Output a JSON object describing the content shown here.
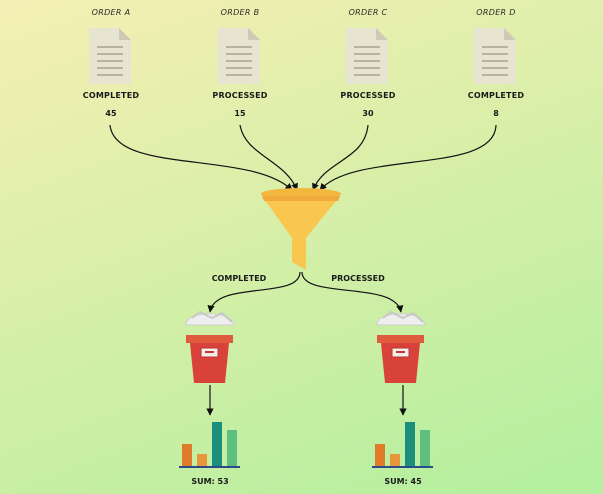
{
  "orders": [
    {
      "title": "ORDER A",
      "status": "COMPLETED",
      "count": "45"
    },
    {
      "title": "ORDER B",
      "status": "PROCESSED",
      "count": "15"
    },
    {
      "title": "ORDER C",
      "status": "PROCESSED",
      "count": "30"
    },
    {
      "title": "ORDER D",
      "status": "COMPLETED",
      "count": "8"
    }
  ],
  "branches": [
    {
      "label": "COMPLETED",
      "sum": "SUM: 53"
    },
    {
      "label": "PROCESSED",
      "sum": "SUM: 45"
    }
  ],
  "colors": {
    "funnel": "#f9c74f",
    "bin": "#d9423a",
    "bar_orange": "#e07b2a",
    "bar_teal": "#1b8f7a",
    "bar_green": "#5fbf7f"
  },
  "icons": [
    "document-icon",
    "funnel-icon",
    "bin-icon",
    "bar-chart-icon"
  ]
}
